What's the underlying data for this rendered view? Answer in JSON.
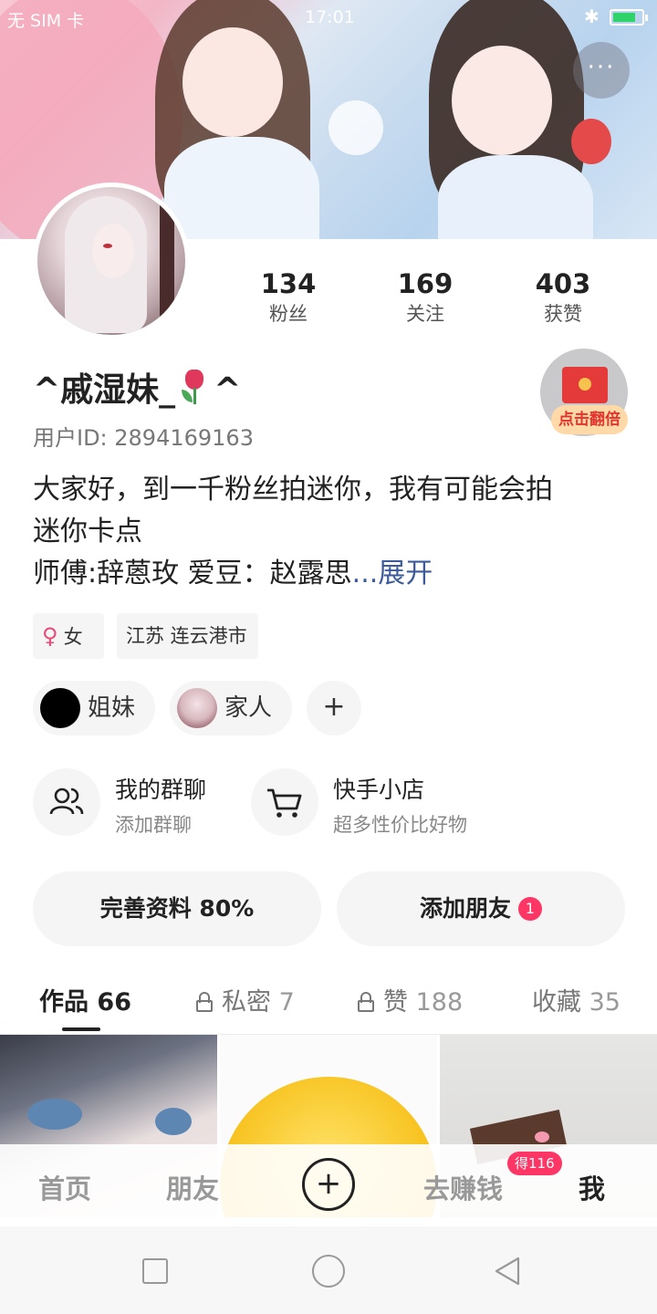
{
  "status_bar": {
    "carrier": "无 SIM 卡",
    "time": "17:01",
    "battery_level": 0.8
  },
  "header": {
    "more_label": "···"
  },
  "stats": [
    {
      "value": "134",
      "label": "粉丝"
    },
    {
      "value": "169",
      "label": "关注"
    },
    {
      "value": "403",
      "label": "获赞"
    }
  ],
  "profile": {
    "name_prefix": "^戚湿妹_",
    "name_suffix": "^",
    "user_id": "用户ID: 2894169163",
    "bio_line1": "大家好，到一千粉丝拍迷你，我有可能会拍",
    "bio_line2": "迷你卡点",
    "bio_line3": "师傅:辞蒽玫 爱豆：赵露思",
    "bio_expand": "...展开",
    "gender": "女",
    "location": "江苏 连云港市"
  },
  "red_packet": {
    "label": "点击翻倍"
  },
  "circles": [
    {
      "label": "姐妹"
    },
    {
      "label": "家人"
    }
  ],
  "circle_add": "+",
  "services": [
    {
      "title": "我的群聊",
      "subtitle": "添加群聊",
      "icon": "group-icon"
    },
    {
      "title": "快手小店",
      "subtitle": "超多性价比好物",
      "icon": "cart-icon"
    }
  ],
  "actions": {
    "complete_profile": "完善资料 80%",
    "add_friend": "添加朋友",
    "add_friend_badge": "1"
  },
  "tabs": [
    {
      "label": "作品",
      "count": "66",
      "locked": false,
      "active": true
    },
    {
      "label": "私密",
      "count": "7",
      "locked": true,
      "active": false
    },
    {
      "label": "赞",
      "count": "188",
      "locked": true,
      "active": false
    },
    {
      "label": "收藏",
      "count": "35",
      "locked": false,
      "active": false
    }
  ],
  "bottom_nav": {
    "home": "首页",
    "friends": "朋友",
    "plus": "+",
    "earn": "去赚钱",
    "earn_badge": "得116",
    "me": "我"
  }
}
